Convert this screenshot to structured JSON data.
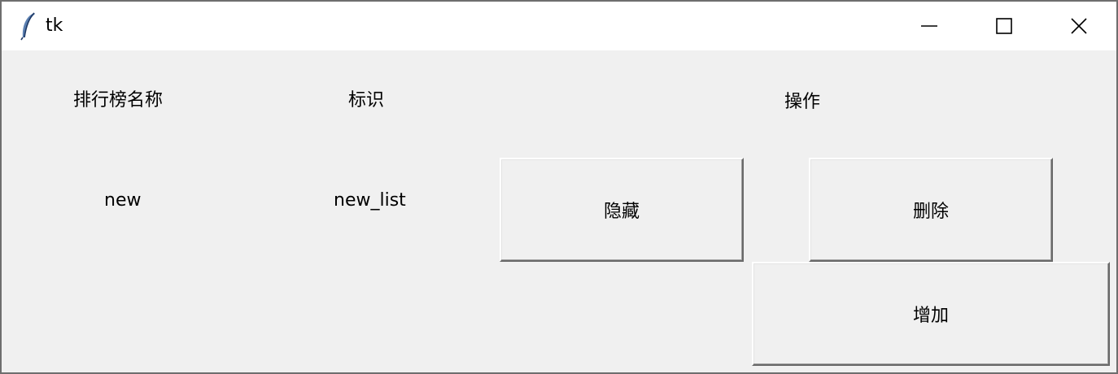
{
  "window": {
    "title": "tk",
    "controls": {
      "minimize_icon": "minimize-icon",
      "maximize_icon": "maximize-icon",
      "close_icon": "close-icon"
    }
  },
  "table": {
    "headers": {
      "name": "排行榜名称",
      "identifier": "标识",
      "actions": "操作"
    },
    "rows": [
      {
        "name": "new",
        "identifier": "new_list",
        "hide_label": "隐藏",
        "delete_label": "删除"
      }
    ]
  },
  "add_button_label": "增加"
}
